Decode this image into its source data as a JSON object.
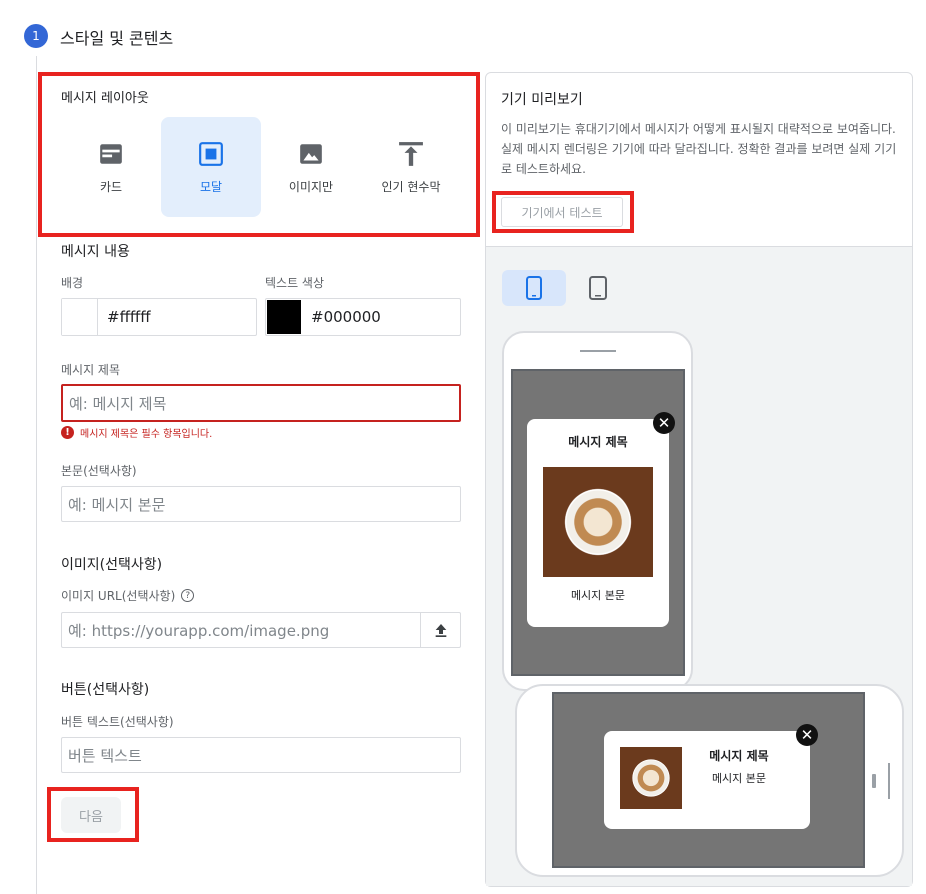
{
  "step": {
    "number": "1",
    "title": "스타일 및 콘텐츠"
  },
  "layout": {
    "heading": "메시지 레이아웃",
    "options": [
      {
        "label": "카드",
        "icon": "card-icon",
        "selected": false
      },
      {
        "label": "모달",
        "icon": "modal-icon",
        "selected": true
      },
      {
        "label": "이미지만",
        "icon": "image-icon",
        "selected": false
      },
      {
        "label": "인기 현수막",
        "icon": "banner-top-icon",
        "selected": false
      }
    ]
  },
  "content": {
    "heading": "메시지 내용",
    "background_label": "배경",
    "background_value": "#ffffff",
    "text_color_label": "텍스트 색상",
    "text_color_value": "#000000",
    "title_label": "메시지 제목",
    "title_placeholder": "예: 메시지 제목",
    "title_error": "메시지 제목은 필수 항목입니다.",
    "body_label": "본문(선택사항)",
    "body_placeholder": "예: 메시지 본문"
  },
  "image": {
    "heading": "이미지(선택사항)",
    "url_label": "이미지 URL(선택사항)",
    "url_placeholder": "예: https://yourapp.com/image.png"
  },
  "button": {
    "heading": "버튼(선택사항)",
    "text_label": "버튼 텍스트(선택사항)",
    "text_placeholder": "버튼 텍스트"
  },
  "next_label": "다음",
  "preview": {
    "heading": "기기 미리보기",
    "description": "이 미리보기는 휴대기기에서 메시지가 어떻게 표시될지 대략적으로 보여줍니다. 실제 메시지 렌더링은 기기에 따라 달라집니다. 정확한 결과를 보려면 실제 기기로 테스트하세요.",
    "test_button": "기기에서 테스트",
    "modal_title": "메시지 제목",
    "modal_body": "메시지 본문",
    "selected_device": "phone"
  },
  "colors": {
    "accent": "#1a73e8",
    "error": "#c5221f",
    "highlight": "#e8231f",
    "step_badge": "#3367d6"
  }
}
